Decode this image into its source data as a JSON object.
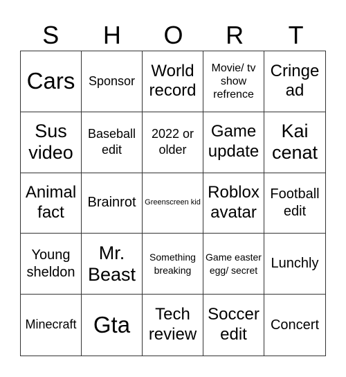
{
  "title_letters": [
    "S",
    "H",
    "O",
    "R",
    "T"
  ],
  "cells": [
    {
      "text": "Cars",
      "size": "xl"
    },
    {
      "text": "Sponsor",
      "size": "s"
    },
    {
      "text": "World record",
      "size": "m"
    },
    {
      "text": "Movie/ tv show refrence",
      "size": "xs"
    },
    {
      "text": "Cringe ad",
      "size": "m"
    },
    {
      "text": "Sus video",
      "size": "l"
    },
    {
      "text": "Baseball edit",
      "size": "s"
    },
    {
      "text": "2022 or older",
      "size": "s"
    },
    {
      "text": "Game update",
      "size": "m"
    },
    {
      "text": "Kai cenat",
      "size": "l"
    },
    {
      "text": "Animal fact",
      "size": "m"
    },
    {
      "text": "Brainrot",
      "size": "ms"
    },
    {
      "text": "Greenscreen kid",
      "size": "tiny"
    },
    {
      "text": "Roblox avatar",
      "size": "m"
    },
    {
      "text": "Football edit",
      "size": "ms"
    },
    {
      "text": "Young sheldon",
      "size": "ms"
    },
    {
      "text": "Mr. Beast",
      "size": "l"
    },
    {
      "text": "Something breaking",
      "size": "xxs"
    },
    {
      "text": "Game easter egg/ secret",
      "size": "xxs"
    },
    {
      "text": "Lunchly",
      "size": "ms"
    },
    {
      "text": "Minecraft",
      "size": "s"
    },
    {
      "text": "Gta",
      "size": "xl"
    },
    {
      "text": "Tech review",
      "size": "m"
    },
    {
      "text": "Soccer edit",
      "size": "m"
    },
    {
      "text": "Concert",
      "size": "ms"
    }
  ]
}
